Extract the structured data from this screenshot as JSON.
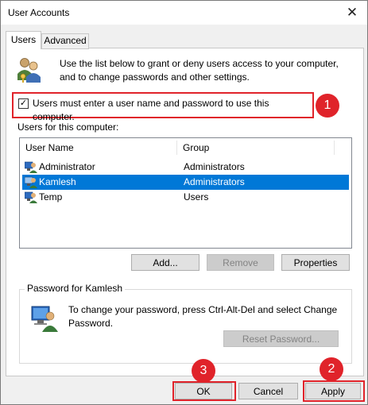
{
  "window": {
    "title": "User Accounts",
    "close_glyph": "✕"
  },
  "tabs": [
    {
      "label": "Users",
      "active": true
    },
    {
      "label": "Advanced",
      "active": false
    }
  ],
  "intro": "Use the list below to grant or deny users access to your computer, and to change passwords and other settings.",
  "checkbox": {
    "label": "Users must enter a user name and password to use this computer.",
    "checked": true,
    "mark": "✓"
  },
  "users_list": {
    "caption": "Users for this computer:",
    "columns": [
      "User Name",
      "Group"
    ],
    "rows": [
      {
        "name": "Administrator",
        "group": "Administrators",
        "selected": false
      },
      {
        "name": "Kamlesh",
        "group": "Administrators",
        "selected": true
      },
      {
        "name": "Temp",
        "group": "Users",
        "selected": false
      }
    ]
  },
  "list_buttons": {
    "add": "Add...",
    "remove": "Remove",
    "properties": "Properties"
  },
  "password_group": {
    "legend": "Password for Kamlesh",
    "text": "To change your password, press Ctrl-Alt-Del and select Change Password.",
    "reset_button": "Reset Password..."
  },
  "footer_buttons": {
    "ok": "OK",
    "cancel": "Cancel",
    "apply": "Apply"
  },
  "annotations": {
    "badge_1": "1",
    "badge_2": "2",
    "badge_3": "3"
  },
  "colors": {
    "accent": "#0078d7",
    "highlight": "#e0232a"
  }
}
